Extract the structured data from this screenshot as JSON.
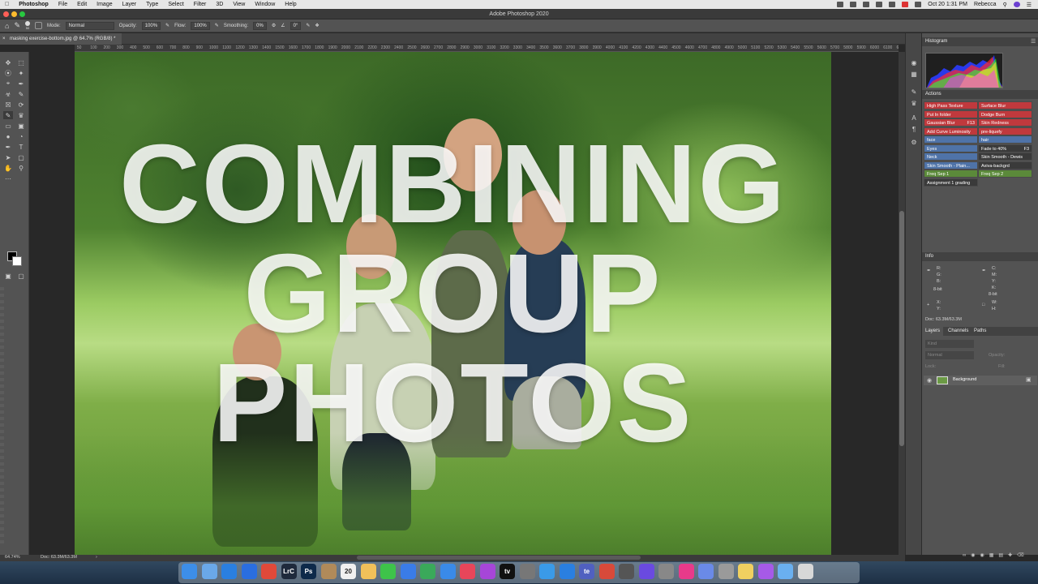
{
  "menubar": {
    "app": "Photoshop",
    "items": [
      "File",
      "Edit",
      "Image",
      "Layer",
      "Type",
      "Select",
      "Filter",
      "3D",
      "View",
      "Window",
      "Help"
    ],
    "datetime": "Oct 20  1:31 PM",
    "user": "Rebecca"
  },
  "window": {
    "title": "Adobe Photoshop 2020"
  },
  "options": {
    "mode_label": "Mode:",
    "mode_value": "Normal",
    "opacity_label": "Opacity:",
    "opacity_value": "100%",
    "flow_label": "Flow:",
    "flow_value": "100%",
    "smoothing_label": "Smoothing:",
    "smoothing_value": "0%",
    "angle_value": "0°",
    "brush_size": "50"
  },
  "document": {
    "tab_title": "masking exercise-bottom.jpg @ 64.7% (RGB/8) *"
  },
  "ruler": [
    "100",
    "50",
    "0",
    "50",
    "100",
    "200",
    "300",
    "400",
    "500",
    "600",
    "700",
    "800",
    "900",
    "1000",
    "1100",
    "1200",
    "1300",
    "1400",
    "1500",
    "1600",
    "1700",
    "1800",
    "1900",
    "2000",
    "2100",
    "2200",
    "2300",
    "2400",
    "2500",
    "2600",
    "2700",
    "2800",
    "2900",
    "3000",
    "3100",
    "3200",
    "3300",
    "3400",
    "3500",
    "3600",
    "3700",
    "3800",
    "3900",
    "4000",
    "4100",
    "4200",
    "4300",
    "4400",
    "4500",
    "4600",
    "4700",
    "4800",
    "4900",
    "5000",
    "5100",
    "5200",
    "5300",
    "5400",
    "5500",
    "5600",
    "5700",
    "5800",
    "5900",
    "6000",
    "6100",
    "62"
  ],
  "overlay": {
    "lines": [
      "COMBINING",
      "GROUP",
      "PHOTOS"
    ]
  },
  "panels": {
    "histogram_tab": "Histogram",
    "actions_tab": "Actions",
    "actions": [
      {
        "label": "High Pass Texture",
        "color": "#c0393d"
      },
      {
        "label": "Surface Blur",
        "color": "#c0393d"
      },
      {
        "label": "Put In folder",
        "color": "#c0393d"
      },
      {
        "label": "Dodge Burn",
        "color": "#c0393d"
      },
      {
        "label": "Gaussian Blur",
        "color": "#c0393d",
        "key": "F13"
      },
      {
        "label": "Skin Redness",
        "color": "#c0393d"
      },
      {
        "label": "Add Curve Luminosity",
        "color": "#c0393d"
      },
      {
        "label": "pre-liquefy",
        "color": "#c0393d"
      },
      {
        "label": "face",
        "color": "#4f73a8"
      },
      {
        "label": "hair",
        "color": "#4f73a8"
      },
      {
        "label": "Eyes",
        "color": "#4f73a8"
      },
      {
        "label": "Fade to 40%",
        "color": "#3a3a3a",
        "key": "F3"
      },
      {
        "label": "Neck",
        "color": "#4f73a8"
      },
      {
        "label": "Skin Smooth - Dewis",
        "color": "#3a3a3a"
      },
      {
        "label": "Skin Smooth - Plain...",
        "color": "#4f73a8"
      },
      {
        "label": "Axiva-backgrd",
        "color": "#3a3a3a"
      },
      {
        "label": "Freq Sep 1",
        "color": "#5b8a3a"
      },
      {
        "label": "Freq Sep 2",
        "color": "#5b8a3a"
      },
      {
        "label": "Assignment 1 grading",
        "color": "#3a3a3a"
      }
    ],
    "info_tab": "Info",
    "info": {
      "r": "R:",
      "g": "G:",
      "b": "B:",
      "bit1": "8-bit",
      "c": "C:",
      "m": "M:",
      "y": "Y:",
      "k": "K:",
      "bit2": "8-bit",
      "x": "X:",
      "yy": "Y:",
      "w": "W:",
      "h": "H:",
      "doc": "Doc: 63.3M/63.3M"
    },
    "layers_tabs": [
      "Layers",
      "Channels",
      "Paths"
    ],
    "layers_kind": "Kind",
    "layers_blend": "Normal",
    "layers_opacity": "Opacity:",
    "layers_lock": "Lock:",
    "layers_fill": "Fill:",
    "layer_name": "Background"
  },
  "status": {
    "zoom": "64.74%",
    "doc": "Doc: 63.3M/63.3M"
  },
  "dock": {
    "apps": [
      {
        "name": "finder",
        "label": "",
        "color": "#3d8ee8"
      },
      {
        "name": "launchpad",
        "label": "",
        "color": "#6aa8e8"
      },
      {
        "name": "safari",
        "label": "",
        "color": "#2a7fe0"
      },
      {
        "name": "reminders",
        "label": "",
        "color": "#2a6ee0"
      },
      {
        "name": "chrome",
        "label": "",
        "color": "#e0493a"
      },
      {
        "name": "lightroom",
        "label": "LrC",
        "color": "#1f2a3c"
      },
      {
        "name": "photoshop",
        "label": "Ps",
        "color": "#0e2a4a"
      },
      {
        "name": "contacts",
        "label": "",
        "color": "#b08a5a"
      },
      {
        "name": "calendar",
        "label": "20",
        "color": "#f0f0f0"
      },
      {
        "name": "photos",
        "label": "",
        "color": "#f0c05a"
      },
      {
        "name": "messages",
        "label": "",
        "color": "#3ec34a"
      },
      {
        "name": "messenger",
        "label": "",
        "color": "#3a7ce8"
      },
      {
        "name": "numbers",
        "label": "",
        "color": "#3aa95a"
      },
      {
        "name": "keynote",
        "label": "",
        "color": "#3a8ae8"
      },
      {
        "name": "music",
        "label": "",
        "color": "#e8465a"
      },
      {
        "name": "podcasts",
        "label": "",
        "color": "#a646d8"
      },
      {
        "name": "appletv",
        "label": "tv",
        "color": "#111111"
      },
      {
        "name": "preferences",
        "label": "",
        "color": "#777777"
      },
      {
        "name": "tasks",
        "label": "",
        "color": "#3a9ae8"
      },
      {
        "name": "appstore",
        "label": "",
        "color": "#2a7fe0"
      },
      {
        "name": "teams",
        "label": "te",
        "color": "#5060c0"
      },
      {
        "name": "pdf",
        "label": "",
        "color": "#d84a3a"
      },
      {
        "name": "netnewswire",
        "label": "",
        "color": "#555555"
      },
      {
        "name": "siri",
        "label": "",
        "color": "#6a4ae0"
      },
      {
        "name": "compass",
        "label": "",
        "color": "#888888"
      },
      {
        "name": "lips",
        "label": "",
        "color": "#e83a8a"
      },
      {
        "name": "pen",
        "label": "",
        "color": "#6a8ae8"
      },
      {
        "name": "preview",
        "label": "",
        "color": "#9a9a9a"
      },
      {
        "name": "notes",
        "label": "",
        "color": "#f0d060"
      },
      {
        "name": "star",
        "label": "",
        "color": "#a65ae8"
      },
      {
        "name": "folder",
        "label": "",
        "color": "#6ab0f0"
      },
      {
        "name": "trash",
        "label": "",
        "color": "#d8d8d8"
      }
    ]
  }
}
